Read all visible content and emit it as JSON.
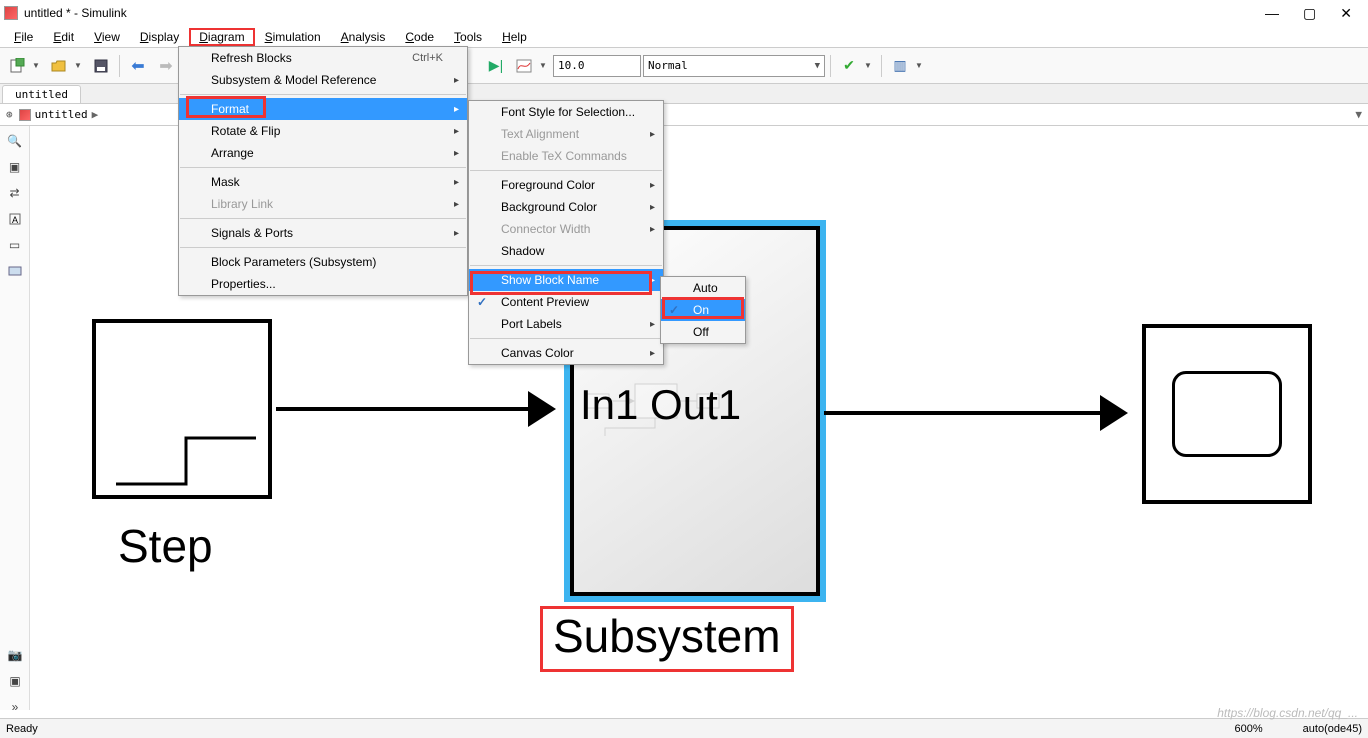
{
  "title": "untitled * - Simulink",
  "window_controls": {
    "min": "—",
    "max": "▢",
    "close": "✕"
  },
  "menubar": [
    "File",
    "Edit",
    "View",
    "Display",
    "Diagram",
    "Simulation",
    "Analysis",
    "Code",
    "Tools",
    "Help"
  ],
  "menubar_highlight_index": 4,
  "toolbar": {
    "time": "10.0",
    "mode": "Normal"
  },
  "tab": "untitled",
  "breadcrumb": "untitled",
  "diagram_menu": {
    "items": [
      {
        "label": "Refresh Blocks",
        "shortcut": "Ctrl+K"
      },
      {
        "label": "Subsystem & Model Reference",
        "sub": true
      },
      {
        "sep": true
      },
      {
        "label": "Format",
        "sub": true,
        "sel": true,
        "highlight": true
      },
      {
        "label": "Rotate & Flip",
        "sub": true
      },
      {
        "label": "Arrange",
        "sub": true
      },
      {
        "sep": true
      },
      {
        "label": "Mask",
        "sub": true
      },
      {
        "label": "Library Link",
        "sub": true,
        "disabled": true
      },
      {
        "sep": true
      },
      {
        "label": "Signals & Ports",
        "sub": true
      },
      {
        "sep": true
      },
      {
        "label": "Block Parameters (Subsystem)"
      },
      {
        "label": "Properties..."
      }
    ]
  },
  "format_menu": {
    "items": [
      {
        "label": "Font Style for Selection..."
      },
      {
        "label": "Text Alignment",
        "sub": true,
        "disabled": true
      },
      {
        "label": "Enable TeX Commands",
        "disabled": true
      },
      {
        "sep": true
      },
      {
        "label": "Foreground Color",
        "sub": true
      },
      {
        "label": "Background Color",
        "sub": true
      },
      {
        "label": "Connector Width",
        "sub": true,
        "disabled": true
      },
      {
        "label": "Shadow"
      },
      {
        "sep": true
      },
      {
        "label": "Show Block Name",
        "sub": true,
        "sel": true,
        "highlight": true
      },
      {
        "label": "Content Preview",
        "check": true
      },
      {
        "label": "Port Labels",
        "sub": true
      },
      {
        "sep": true
      },
      {
        "label": "Canvas Color",
        "sub": true
      }
    ]
  },
  "show_block_name_menu": {
    "items": [
      {
        "label": "Auto"
      },
      {
        "label": "On",
        "sel": true,
        "check": true,
        "highlight": true
      },
      {
        "label": "Off"
      }
    ]
  },
  "canvas": {
    "step_label": "Step",
    "subsystem_io": "In1 Out1",
    "subsystem_label": "Subsystem"
  },
  "statusbar": {
    "left": "Ready",
    "zoom": "600%",
    "solver": "auto(ode45)"
  },
  "watermark": "https://blog.csdn.net/qq_..."
}
